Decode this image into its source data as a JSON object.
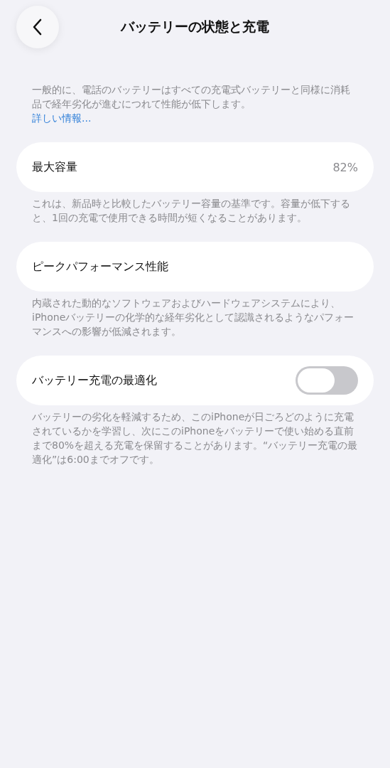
{
  "header": {
    "title": "バッテリーの状態と充電"
  },
  "intro": {
    "text": "一般的に、電話のバッテリーはすべての充電式バッテリーと同様に消耗品で経年劣化が進むにつれて性能が低下します。",
    "link": "詳しい情報..."
  },
  "sections": [
    {
      "kind": "value",
      "label": "最大容量",
      "value": "82%",
      "footer": "これは、新品時と比較したバッテリー容量の基準です。容量が低下すると、1回の充電で使用できる時間が短くなることがあります。"
    },
    {
      "kind": "plain",
      "label": "ピークパフォーマンス性能",
      "footer": "内蔵された動的なソフトウェアおよびハードウェアシステムにより、iPhoneバッテリーの化学的な経年劣化として認識されるようなパフォーマンスへの影響が低減されます。"
    },
    {
      "kind": "toggle",
      "label": "バッテリー充電の最適化",
      "on": false,
      "footer": "バッテリーの劣化を軽減するため、このiPhoneが日ごろどのように充電されているかを学習し、次にこのiPhoneをバッテリーで使い始める直前まで80%を超える充電を保留することがあります。“バッテリー充電の最適化”は6:00までオフです。"
    }
  ]
}
